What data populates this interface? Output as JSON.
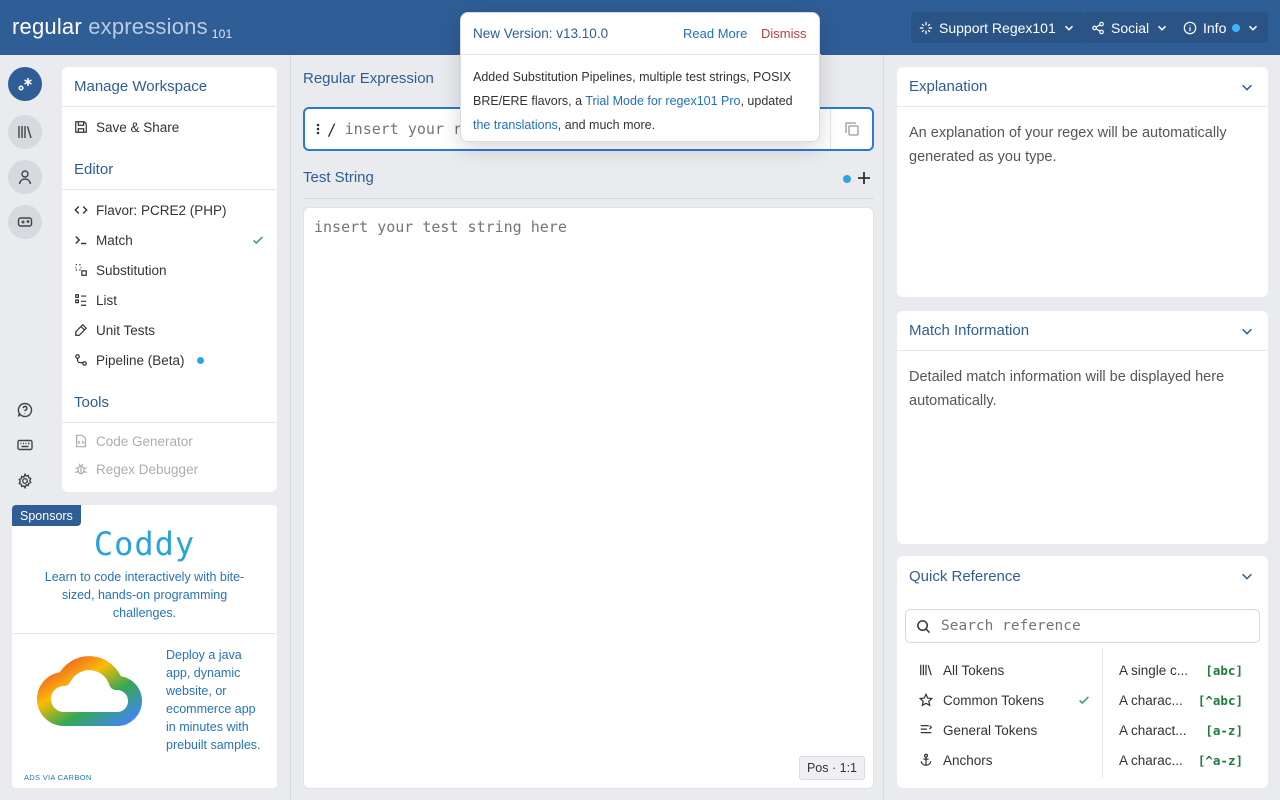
{
  "header": {
    "logo_main": "regular",
    "logo_light": "expressions",
    "logo_sub": "101",
    "support_label": "Support Regex101",
    "social_label": "Social",
    "info_label": "Info"
  },
  "popup": {
    "title": "New Version: v13.10.0",
    "read_more": "Read More",
    "dismiss": "Dismiss",
    "body_1": "Added Substitution Pipelines, multiple test strings, POSIX BRE/ERE flavors, a ",
    "link_trial": "Trial Mode for regex101 Pro",
    "body_2": ", updated ",
    "link_translations": "the translations",
    "body_3": ", and much more."
  },
  "sidebar": {
    "workspace_title": "Manage Workspace",
    "save_share": "Save & Share",
    "editor_title": "Editor",
    "flavor_prefix": "Flavor: ",
    "flavor_value": "PCRE2 (PHP)",
    "items": [
      {
        "label": "Match"
      },
      {
        "label": "Substitution"
      },
      {
        "label": "List"
      },
      {
        "label": "Unit Tests"
      },
      {
        "label": "Pipeline (Beta)"
      }
    ],
    "tools_title": "Tools",
    "tools": [
      {
        "label": "Code Generator"
      },
      {
        "label": "Regex Debugger"
      }
    ]
  },
  "sponsor": {
    "tag": "Sponsors",
    "brand": "Coddy",
    "text": "Learn to code interactively with bite-sized, hands-on programming challenges.",
    "ad_text": "Deploy a java app, dynamic website, or ecommerce app in minutes with prebuilt samples.",
    "ad_via": "ADS VIA CARBON"
  },
  "editor": {
    "regex_label": "Regular Expression",
    "delimiter": "/",
    "regex_placeholder": "insert your regular expression here",
    "test_label": "Test String",
    "test_placeholder": "insert your test string here",
    "pos": "Pos · 1:1"
  },
  "explanation": {
    "title": "Explanation",
    "text": "An explanation of your regex will be automatically generated as you type."
  },
  "match_info": {
    "title": "Match Information",
    "text": "Detailed match information will be displayed here automatically."
  },
  "quick_ref": {
    "title": "Quick Reference",
    "search_placeholder": "Search reference",
    "categories": [
      {
        "label": "All Tokens"
      },
      {
        "label": "Common Tokens"
      },
      {
        "label": "General Tokens"
      },
      {
        "label": "Anchors"
      }
    ],
    "rows": [
      {
        "desc": "A single c...",
        "token": "[abc]"
      },
      {
        "desc": "A charac...",
        "token": "[^abc]"
      },
      {
        "desc": "A charact...",
        "token": "[a-z]"
      },
      {
        "desc": "A charac...",
        "token": "[^a-z]"
      }
    ]
  },
  "colors": {
    "brand": "#2f5d96",
    "accent_blue": "#2a7ad2",
    "check_green": "#3aa36a",
    "dismiss_red": "#c53b3b"
  }
}
